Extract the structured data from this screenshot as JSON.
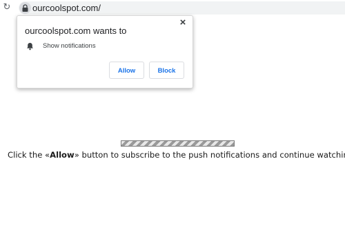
{
  "browser": {
    "reload_icon": "reload-icon",
    "url": "ourcoolspot.com/",
    "lock_icon": "lock-icon"
  },
  "permission_prompt": {
    "title": "ourcoolspot.com wants to",
    "close_label": "×",
    "permission_icon": "bell-icon",
    "permission_label": "Show notifications",
    "allow_label": "Allow",
    "block_label": "Block"
  },
  "page": {
    "message_prefix": "Click the «",
    "message_strong": "Allow",
    "message_suffix": "» button to subscribe to the push notifications and continue watching"
  },
  "colors": {
    "button_text": "#1a73e8",
    "omnibox_bg": "#f1f3f4"
  }
}
